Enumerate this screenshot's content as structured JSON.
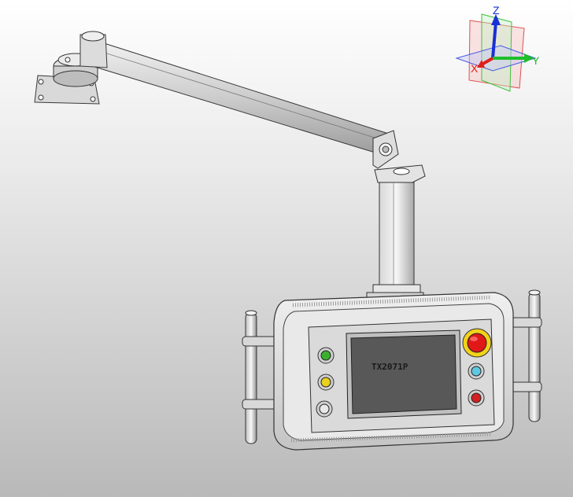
{
  "viewport": {
    "background_top": "#ffffff",
    "background_bottom": "#b9b9b9"
  },
  "triad": {
    "x_label": "X",
    "y_label": "Y",
    "z_label": "Z",
    "x_color": "#e0201c",
    "y_color": "#1fbf2a",
    "z_color": "#1a2fd6"
  },
  "model": {
    "screen_label": "TX2071P",
    "buttons": [
      {
        "name": "green",
        "color": "#3cb02e"
      },
      {
        "name": "yellow",
        "color": "#e6d21f"
      },
      {
        "name": "white",
        "color": "#e8e8e8"
      },
      {
        "name": "cyan",
        "color": "#5ec8e0"
      },
      {
        "name": "red",
        "color": "#d42020"
      }
    ],
    "estop_color": "#e01818",
    "estop_ring_color": "#f2d21a"
  }
}
